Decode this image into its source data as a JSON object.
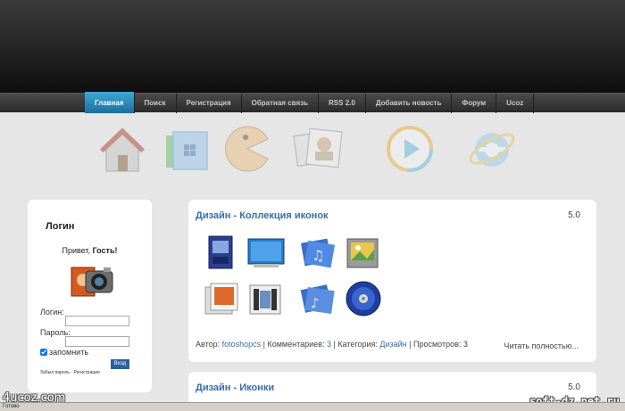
{
  "nav": {
    "items": [
      {
        "label": "Главная",
        "active": true
      },
      {
        "label": "Поиск"
      },
      {
        "label": "Регистрация"
      },
      {
        "label": "Обратная связь"
      },
      {
        "label": "RSS 2.0"
      },
      {
        "label": "Добавить новость"
      },
      {
        "label": "Форум"
      },
      {
        "label": "Ucoz"
      }
    ]
  },
  "icons_row": [
    "home-icon",
    "windows-icon",
    "pacman-icon",
    "photos-icon",
    "media-play-icon",
    "internet-explorer-icon"
  ],
  "sidebar": {
    "title": "Логин",
    "greeting_prefix": "Привет, ",
    "greeting_name": "Гость!",
    "login_label": "Логин:",
    "password_label": "Пароль:",
    "remember_label": "запомнить",
    "login_button": "Вход",
    "forgot_link": "Забыл пароль",
    "link_separator": " · ",
    "register_link": "Регистрация"
  },
  "posts": [
    {
      "title": "Дизайн - Коллекция иконок",
      "rating": "5.0",
      "meta_author_label": "Автор: ",
      "author": "fotoshopcs",
      "meta_sep": " | ",
      "comments_label": "Комментариев: ",
      "comments": "3",
      "category_label": "Категория: ",
      "category": "Дизайн",
      "views_label": "Просмотров: ",
      "views": "3",
      "read_more": "Читать полностью..."
    },
    {
      "title": "Дизайн - Иконки",
      "rating": "5.0"
    }
  ],
  "watermarks": {
    "left": "4ucoz.com",
    "right": "soft-dz.net.ru"
  },
  "status": "Готово"
}
